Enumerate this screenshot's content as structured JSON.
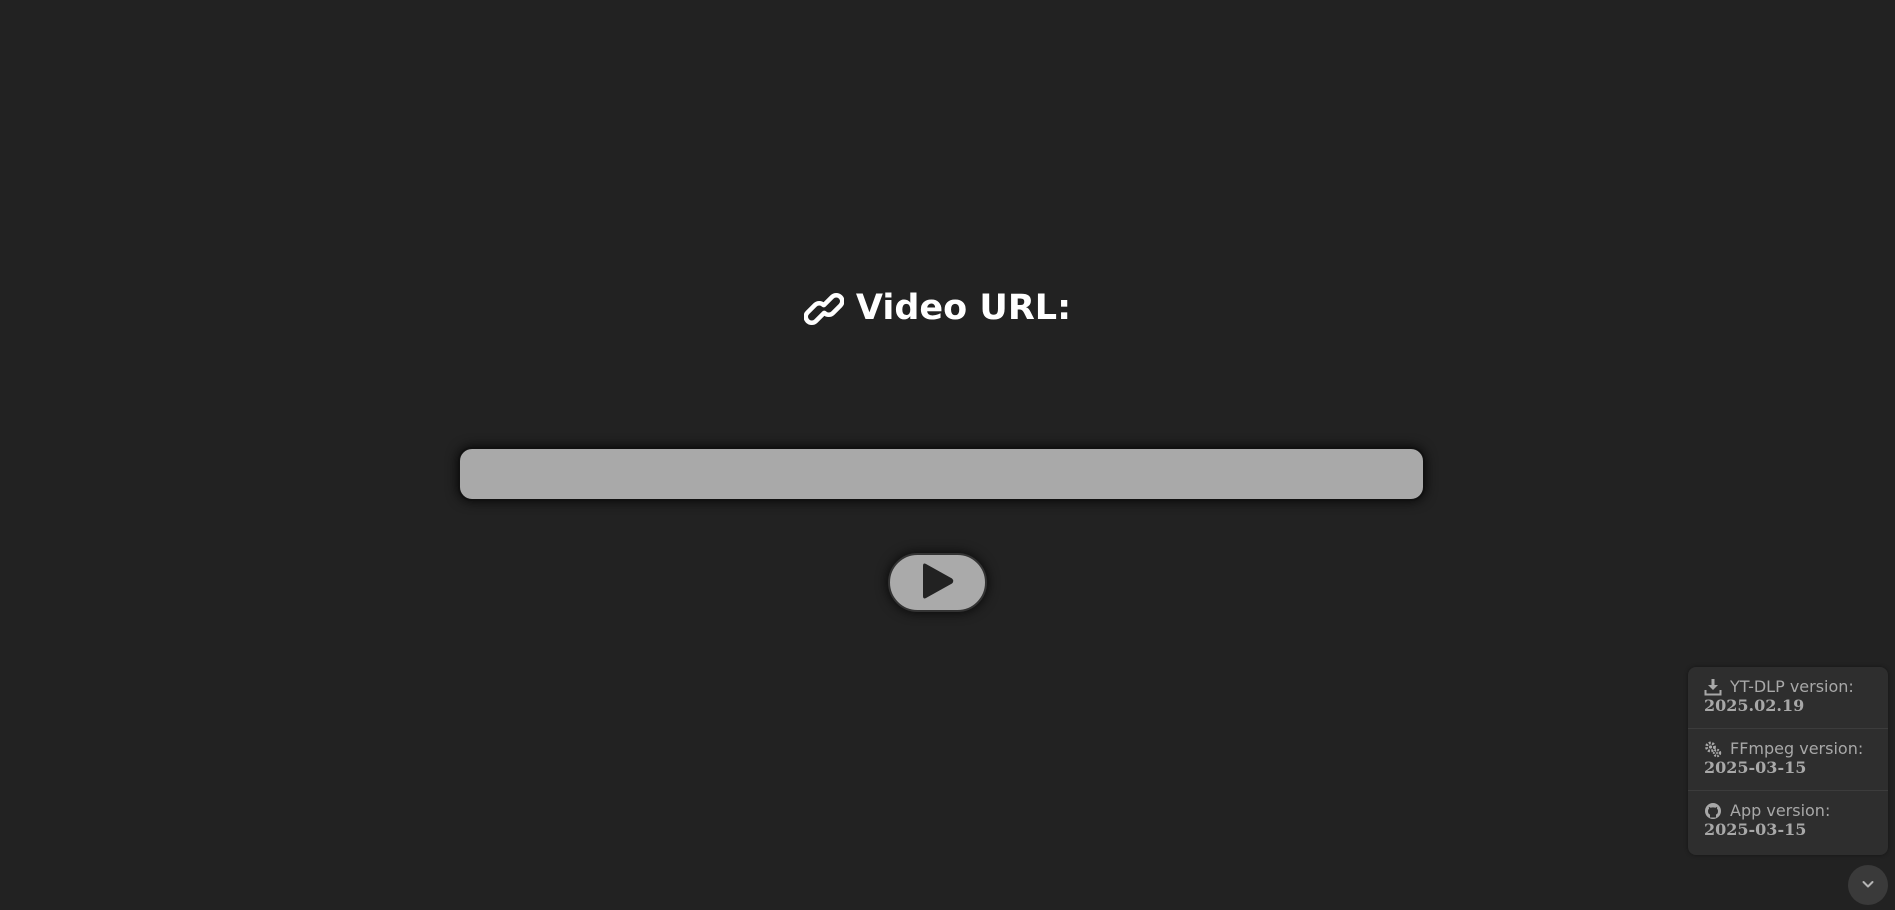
{
  "header": {
    "title": "Video URL:",
    "icon": "link-icon"
  },
  "url_input": {
    "value": "",
    "placeholder": ""
  },
  "play_button": {
    "icon": "play-icon"
  },
  "versions": {
    "items": [
      {
        "icon": "download-icon",
        "label": "YT-DLP version:",
        "value": "2025.02.19"
      },
      {
        "icon": "gears-icon",
        "label": "FFmpeg version:",
        "value": "2025-03-15"
      },
      {
        "icon": "github-icon",
        "label": "App version:",
        "value": "2025-03-15"
      }
    ],
    "collapse_icon": "chevron-down-icon"
  },
  "colors": {
    "background": "#222222",
    "input_background": "#a9a9a9",
    "text_primary": "#ffffff",
    "text_muted": "#a8a8a8"
  }
}
